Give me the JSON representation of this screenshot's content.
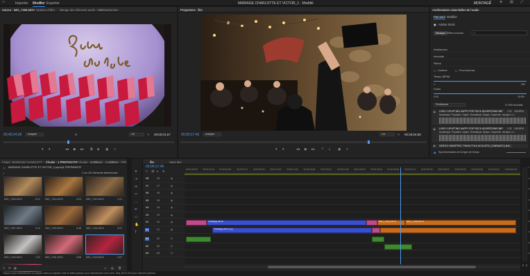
{
  "topbar": {
    "tabs": [
      "Accueil",
      "Importer",
      "Modifier",
      "Exporter"
    ],
    "active_tab": "Modifier",
    "project_title": "MARIAGE CHARLOTTE ET VICTOR_1 - Modifié",
    "workspace": "MONTAGE"
  },
  "source": {
    "tabs": [
      "Source : IMG_7495.MOV",
      "Options d'effet",
      "Mixage des éléments audio : Mix",
      "Métadonnées"
    ],
    "timecode": "00;49;24;06",
    "fit": "Adapter",
    "quality": "1/2",
    "duration": "00;00;01;57"
  },
  "program": {
    "tabs": [
      "Programme : film"
    ],
    "timecode": "00;00;17;46",
    "fit": "Adapter",
    "quality": "1/4",
    "duration": "00;26;04;58"
  },
  "essential_sound": {
    "title": "Améliorations essentielles de l'audio",
    "tabs": [
      "Parcourir",
      "Modifier"
    ],
    "active_tab": "Parcourir",
    "adobe_stock": "Adobe Stock",
    "filters": [
      "Musique",
      "Effets sonores"
    ],
    "search_placeholder": "",
    "sections": [
      "Ambiances",
      "Intensité",
      "Filtres"
    ],
    "checks": [
      "Unisexe",
      "Pour femmes"
    ],
    "tempo_label": "Tempo (BPM)",
    "tempo_min": "1",
    "tempo_max": "200",
    "duration_label": "Durée",
    "duration_min": "0:00",
    "duration_max": "10:00+",
    "sort_label": "Pertinence",
    "result_count": "47 805 résultats",
    "tracks": [
      {
        "title": "LIVELY UPLIFTING HAPPY POP ROCK ADVERTISING IMPRESSIO...",
        "tags": "Dynamique, Populaire, Légère, Dramatique, Épique, Suspense, musique, ro...",
        "time": "2:32",
        "bpm": "108 BPM"
      },
      {
        "title": "LIVELY UPLIFTING HAPPY POP ROCK ADVERTISING IMPRESSIO...",
        "tags": "Dynamique, Populaire, Légère, Dramatique, Épique, Suspense, musique, ro...",
        "time": "2:32",
        "bpm": "108 BPM"
      },
      {
        "title": "GENTLE HEARTFELT PIANO FOLK ACOUSTIC (CINEMATIC) BAC...",
        "tags": "",
        "time": "",
        "bpm": ""
      }
    ],
    "sync_label": "Synchronisation de la ligne de temps"
  },
  "project": {
    "tabs": [
      "Projet : MARIAGE CHARLOTTE ET VICTOR_1",
      "Chutier : 1 PREPARATIF",
      "Chutier : BIJOU",
      "Chutier : GUEST",
      "Chutier : PRISE"
    ],
    "path": "MARIAGE CHARLOTTE ET VICTOR_1.prproj\\1 PREPARATIF",
    "count": "1 sur 101 éléments sélectionnés",
    "thumbs": [
      {
        "name": "IMG_7403.MOV",
        "dur": "0:21"
      },
      {
        "name": "IMG_7404.MOV",
        "dur": "3:20"
      },
      {
        "name": "IMG_7415.MOV",
        "dur": "1:21"
      },
      {
        "name": "IMG_7427.MOV",
        "dur": "3:14"
      },
      {
        "name": "IMG_7420.MOV",
        "dur": "5:38"
      },
      {
        "name": "IMG_7432.MOV",
        "dur": "3:21"
      },
      {
        "name": "IMG_7443.MOV",
        "dur": "1:31"
      },
      {
        "name": "IMG_7441.MOV",
        "dur": "3:06"
      },
      {
        "name": "IMG_7444.MOV",
        "dur": "1:57"
      },
      {
        "name": "IMG_7495.MOV",
        "dur": "1:57"
      }
    ]
  },
  "timeline": {
    "tabs": [
      "film",
      "Sans titre"
    ],
    "timecode": "00;00;17;46",
    "ruler": [
      "00;00;00;00",
      "00;00;02;24",
      "00;00;04;48",
      "00;00;07;12",
      "00;00;09;36",
      "00;00;12;00",
      "00;00;14;24",
      "00;00;16;48",
      "00;00;19;12",
      "00;00;21;36",
      "00;00;24;00",
      "00;00;26;24",
      "00;00;28;48",
      "00;00;31;12",
      "00;00;33;36",
      "00;00;36;00",
      "00;00;38;24",
      "00;00;40;48",
      "00;00;43;12",
      "00;00;45;36"
    ],
    "video_tracks": [
      "V8",
      "V7",
      "V6",
      "V5",
      "V4",
      "V3",
      "V2",
      "V1"
    ],
    "audio_tracks": [
      "A1",
      "A2",
      "A3"
    ],
    "clip_labels": [
      "Photo(s).MOV",
      "Photo(s).MOV [V]",
      "IMG_7531.MOV",
      "IMG_7526.MOV"
    ],
    "meter": [
      "-6",
      "-12",
      "-18",
      "-24",
      "-30",
      "-36",
      "-42",
      "-48",
      "-54"
    ]
  },
  "statusbar": {
    "text": "Cliquez pour sélectionner ou cliquez dans un espace vide et faites glisser pour sélectionner une zone. Maj, Alt et Ctrl pour d'autres options."
  },
  "colors": {
    "accent": "#3d8bf7",
    "video_clip": "#3a4fcf",
    "audio_clip": "#3e8a2e",
    "orange_clip": "#c86b1c",
    "pink_clip": "#c24a8a",
    "playhead": "#4f9cf0"
  }
}
